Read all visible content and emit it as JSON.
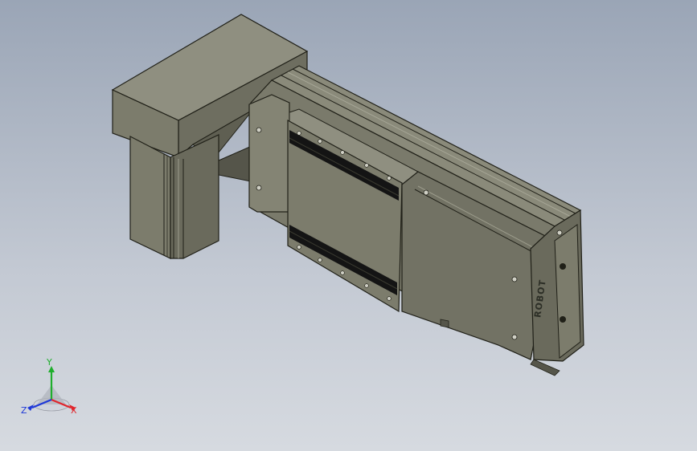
{
  "viewport": {
    "background_top": "#9aa5b6",
    "background_bottom": "#d6dae0"
  },
  "model": {
    "name": "linear-actuator-with-motor",
    "brand_text": "ROBOT",
    "colors": {
      "body": "#7c7c6c",
      "body_dark": "#5f5f52",
      "body_light": "#8f8f80",
      "edge": "#202018",
      "rail_slot": "#141414",
      "screw": "#cfcfc4"
    }
  },
  "triad": {
    "x_label": "X",
    "y_label": "Y",
    "z_label": "Z",
    "x_color": "#e0262d",
    "y_color": "#1fae2d",
    "z_color": "#1e38d8"
  }
}
